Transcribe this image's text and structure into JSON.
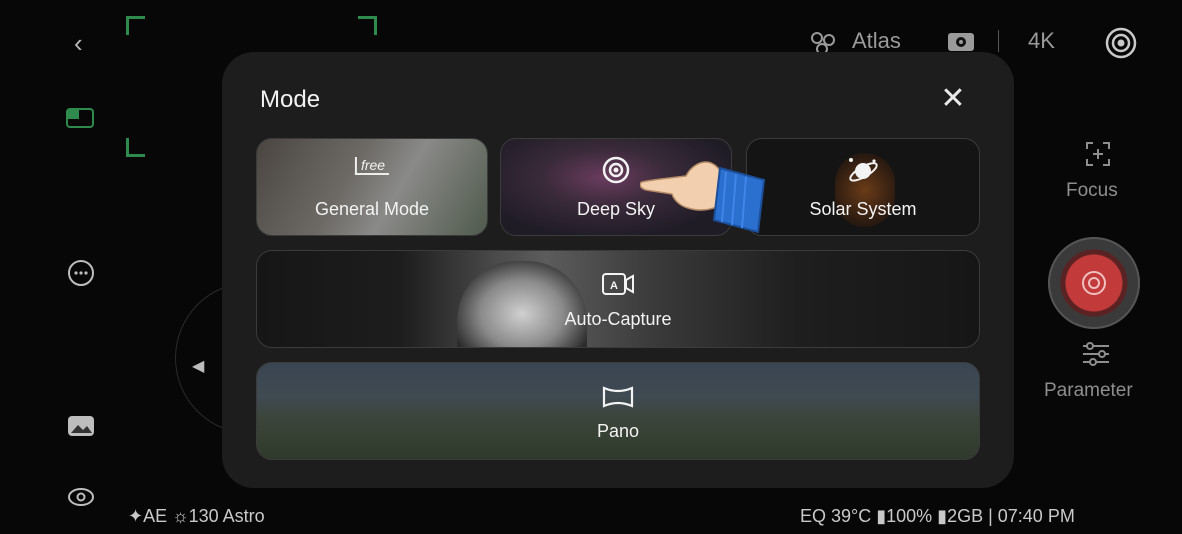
{
  "top_bar": {
    "atlas_label": "Atlas",
    "resolution": "4K"
  },
  "side": {
    "focus_label": "Focus",
    "parameter_label": "Parameter"
  },
  "status": {
    "left": "✦AE ☼130 Astro",
    "right": "EQ 39°C ▮100% ▮2GB | 07:40 PM"
  },
  "modal": {
    "title": "Mode",
    "close_glyph": "✕",
    "modes": {
      "general": {
        "label": "General Mode",
        "badge": "free"
      },
      "deep_sky": {
        "label": "Deep Sky"
      },
      "solar_system": {
        "label": "Solar System"
      },
      "auto_capture": {
        "label": "Auto-Capture"
      },
      "pano": {
        "label": "Pano"
      }
    }
  },
  "colors": {
    "accent_green": "#2f8a4e",
    "shutter_red": "#c23a3a",
    "modal_bg": "#1d1d1d"
  }
}
